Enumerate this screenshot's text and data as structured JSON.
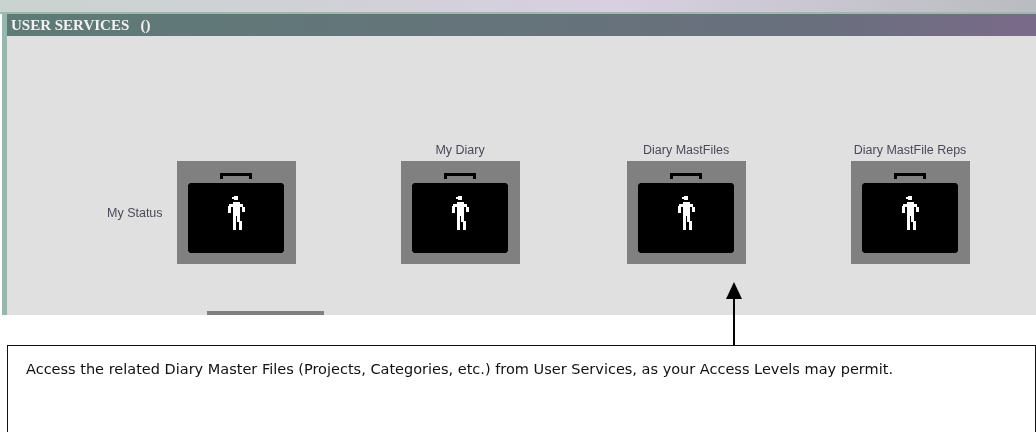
{
  "window": {
    "title": "USER SERVICES   ()"
  },
  "services": [
    {
      "label": "My Status",
      "kind": "side-label"
    },
    {
      "label": "My Diary",
      "kind": "top-label"
    },
    {
      "label": "Diary MastFiles",
      "kind": "top-label"
    },
    {
      "label": "Diary MastFile Reps",
      "kind": "top-label"
    }
  ],
  "callout": {
    "text": "Access the related Diary Master Files (Projects, Categories, etc.) from User Services, as your Access Levels may permit."
  }
}
